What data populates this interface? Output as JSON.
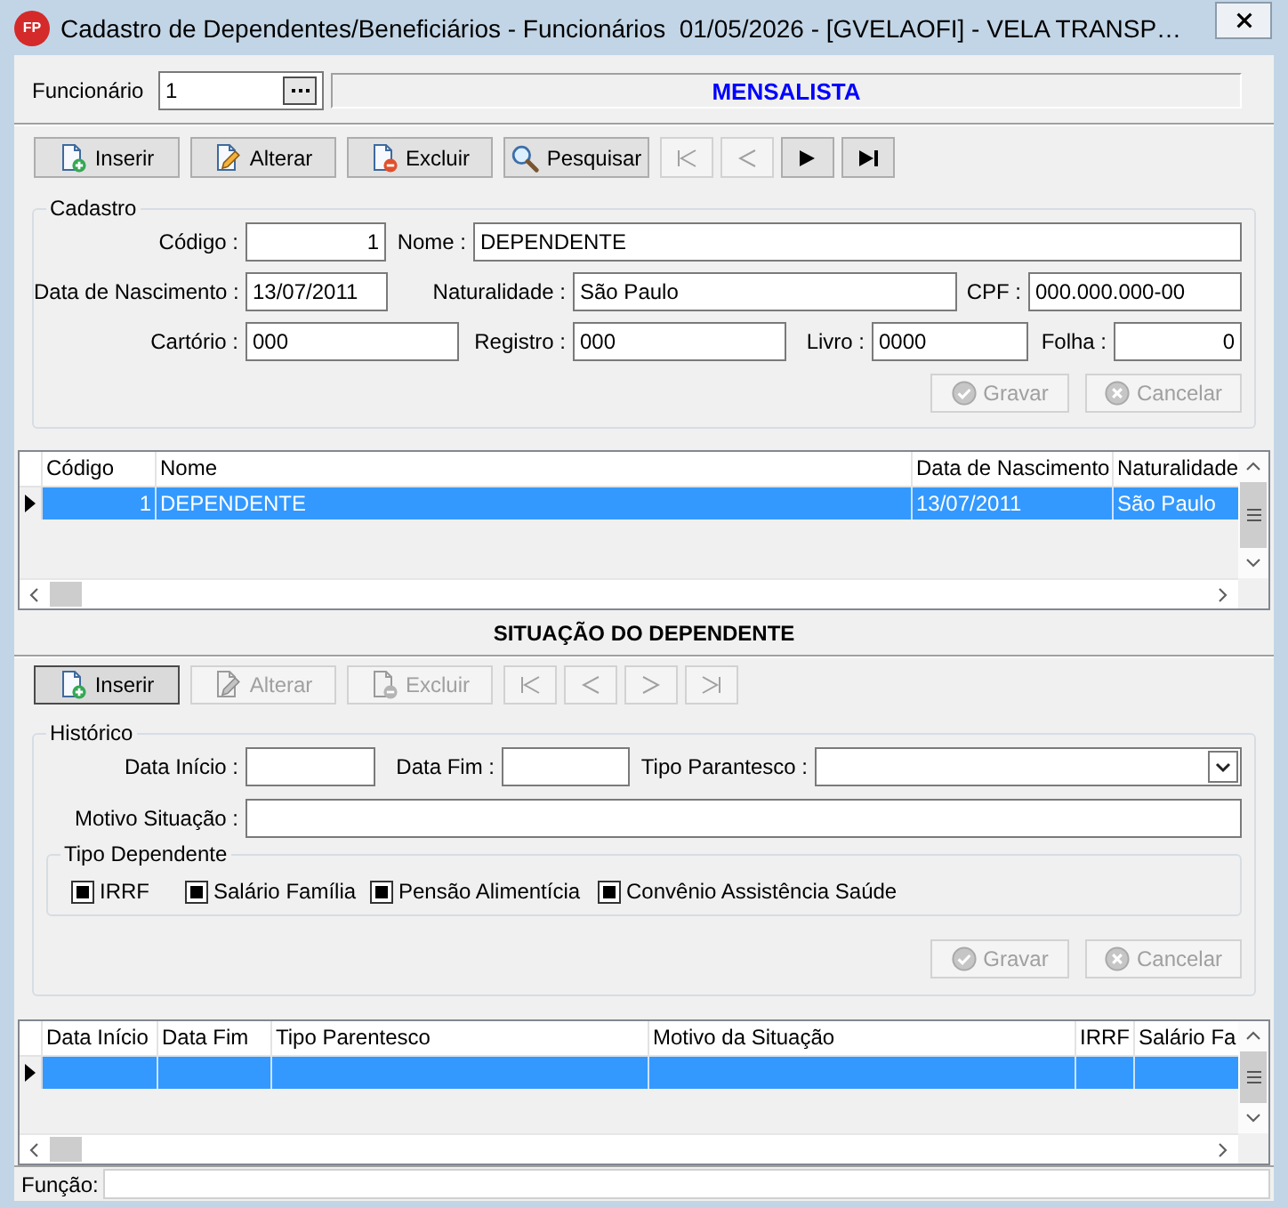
{
  "window": {
    "icon_text": "FP",
    "title": "Cadastro de Dependentes/Beneficiários - Funcionários  01/05/2026 - [GVELAOFI] - VELA TRANSP…"
  },
  "employee": {
    "label": "Funcionário",
    "value": "1",
    "category": "MENSALISTA"
  },
  "toolbar": [
    {
      "kind": "insert",
      "label": "Inserir",
      "disabled": false
    },
    {
      "kind": "edit",
      "label": "Alterar",
      "disabled": false
    },
    {
      "kind": "delete",
      "label": "Excluir",
      "disabled": false
    },
    {
      "kind": "search",
      "label": "Pesquisar",
      "disabled": false
    },
    {
      "kind": "first",
      "disabled": true
    },
    {
      "kind": "prior",
      "disabled": true
    },
    {
      "kind": "next",
      "disabled": false
    },
    {
      "kind": "last",
      "disabled": false
    }
  ],
  "cadastro": {
    "title": "Cadastro",
    "fields": [
      {
        "label": "Código :",
        "value": "1",
        "kind": "number"
      },
      {
        "label": "Nome :",
        "value": "DEPENDENTE",
        "kind": "text"
      },
      {
        "label": "Data de Nascimento :",
        "value": "13/07/2011",
        "kind": "text"
      },
      {
        "label": "Naturalidade :",
        "value": "São Paulo",
        "kind": "text"
      },
      {
        "label": "CPF :",
        "value": "000.000.000-00",
        "kind": "text"
      },
      {
        "label": "Cartório :",
        "value": "000",
        "kind": "text"
      },
      {
        "label": "Registro :",
        "value": "000",
        "kind": "text"
      },
      {
        "label": "Livro :",
        "value": "0000",
        "kind": "text"
      },
      {
        "label": "Folha :",
        "value": "0",
        "kind": "number"
      }
    ],
    "buttons": [
      {
        "kind": "save",
        "label": "Gravar",
        "disabled": true
      },
      {
        "kind": "cancel",
        "label": "Cancelar",
        "disabled": true
      }
    ]
  },
  "dependents_table": {
    "columns": [
      {
        "label": "Código",
        "kind": "number"
      },
      {
        "label": "Nome",
        "kind": "text"
      },
      {
        "label": "Data de Nascimento",
        "kind": "text"
      },
      {
        "label": "Naturalidade",
        "kind": "text"
      }
    ],
    "rows": [
      {
        "cells": [
          "1",
          "DEPENDENTE",
          "13/07/2011",
          "São Paulo"
        ],
        "selected": true
      }
    ]
  },
  "situation": {
    "title": "SITUAÇÃO DO DEPENDENTE",
    "toolbar": [
      {
        "kind": "insert",
        "label": "Inserir",
        "disabled": false,
        "focused": true
      },
      {
        "kind": "edit",
        "label": "Alterar",
        "disabled": true,
        "focused": false
      },
      {
        "kind": "delete",
        "label": "Excluir",
        "disabled": true,
        "focused": false
      },
      {
        "kind": "first",
        "disabled": true,
        "focused": false
      },
      {
        "kind": "prior",
        "disabled": true,
        "focused": false
      },
      {
        "kind": "next",
        "disabled": true,
        "focused": false
      },
      {
        "kind": "last",
        "disabled": true,
        "focused": false
      }
    ],
    "history": {
      "title": "Histórico",
      "fields": [
        {
          "label": "Data Início :",
          "kind": "text"
        },
        {
          "label": "Data Fim :",
          "kind": "text"
        },
        {
          "label": "Tipo Parantesco :",
          "kind": "select"
        },
        {
          "label": "Motivo Situação :",
          "kind": "text"
        }
      ],
      "type_group": {
        "title": "Tipo Dependente",
        "options": [
          {
            "label": "IRRF",
            "checked": false,
            "indeterminate": true
          },
          {
            "label": "Salário Família",
            "checked": false,
            "indeterminate": true
          },
          {
            "label": "Pensão Alimentícia",
            "checked": false,
            "indeterminate": true
          },
          {
            "label": "Convênio Assistência Saúde",
            "checked": false,
            "indeterminate": true
          }
        ]
      },
      "buttons": [
        {
          "kind": "save",
          "label": "Gravar",
          "disabled": true
        },
        {
          "kind": "cancel",
          "label": "Cancelar",
          "disabled": true
        }
      ]
    }
  },
  "history_table": {
    "columns": [
      {
        "label": "Data Início"
      },
      {
        "label": "Data Fim"
      },
      {
        "label": "Tipo Parentesco"
      },
      {
        "label": "Motivo da Situação"
      },
      {
        "label": "IRRF"
      },
      {
        "label": "Salário Fa"
      }
    ],
    "rows": [
      {
        "selected": true
      }
    ]
  },
  "status_bar": {
    "label": "Função:"
  }
}
